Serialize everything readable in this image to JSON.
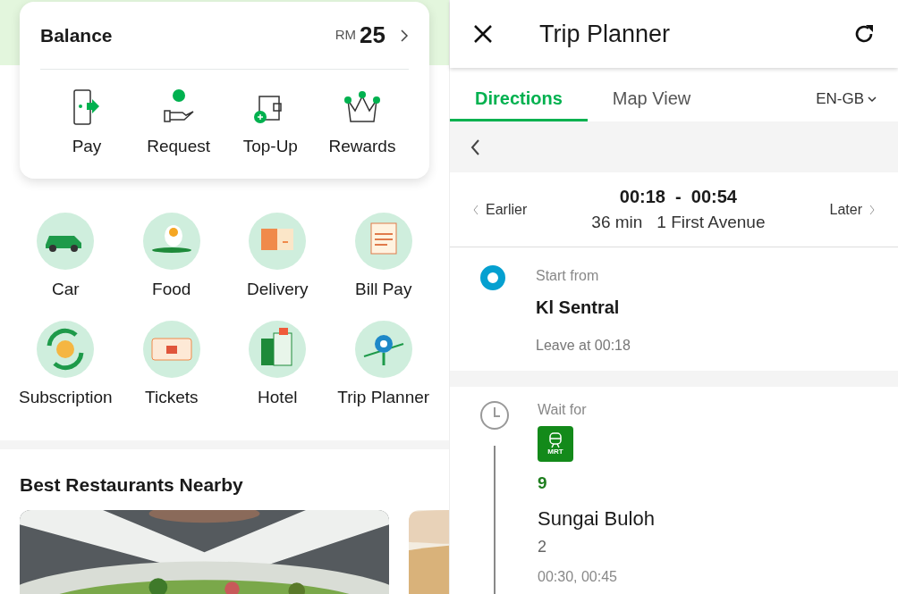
{
  "wallet": {
    "title": "Balance",
    "currency": "RM",
    "amount": "25",
    "actions": [
      {
        "label": "Pay"
      },
      {
        "label": "Request"
      },
      {
        "label": "Top-Up"
      },
      {
        "label": "Rewards"
      }
    ]
  },
  "services": [
    {
      "label": "Car"
    },
    {
      "label": "Food"
    },
    {
      "label": "Delivery"
    },
    {
      "label": "Bill Pay"
    },
    {
      "label": "Subscription"
    },
    {
      "label": "Tickets"
    },
    {
      "label": "Hotel"
    },
    {
      "label": "Trip Planner"
    }
  ],
  "restaurants": {
    "title": "Best Restaurants Nearby"
  },
  "trip_planner": {
    "title": "Trip Planner",
    "tabs": [
      {
        "label": "Directions",
        "selected": true
      },
      {
        "label": "Map View",
        "selected": false
      }
    ],
    "language": "EN-GB",
    "earlier": "Earlier",
    "later": "Later",
    "times": "00:18  -  00:54",
    "duration": "36 min",
    "destination": "1 First Avenue",
    "start": {
      "label": "Start from",
      "place": "Kl Sentral",
      "leave": "Leave at 00:18"
    },
    "wait": {
      "label": "Wait for",
      "badge": "MRT",
      "line": "9",
      "towards": "Sungai Buloh",
      "platform": "2",
      "departures": "00:30, 00:45"
    }
  }
}
